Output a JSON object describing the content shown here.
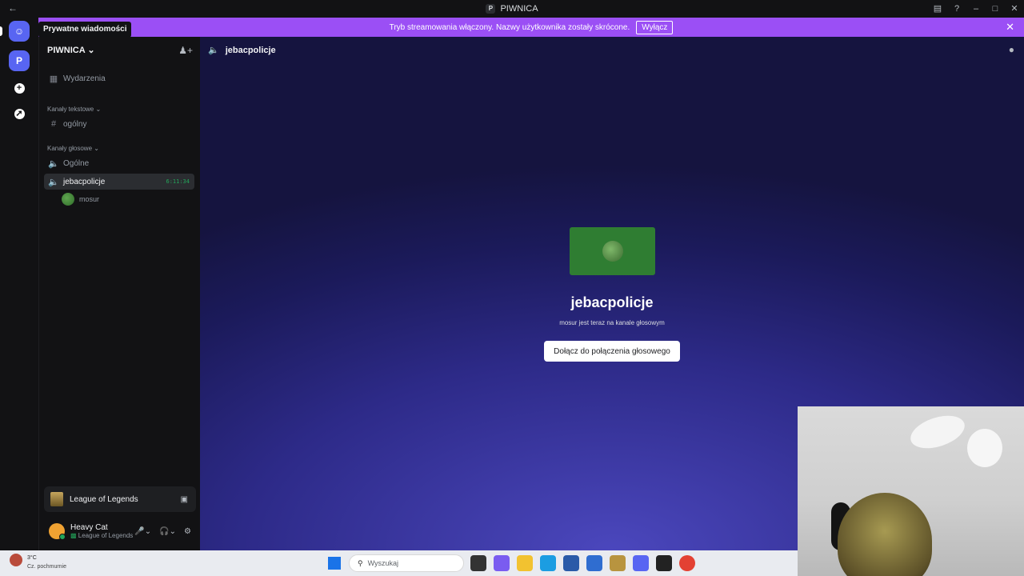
{
  "window": {
    "title": "PIWNICA",
    "badge": "P"
  },
  "banner": {
    "text": "Tryb streamowania włączony. Nazwy użytkownika zostały skrócone.",
    "button": "Wyłącz"
  },
  "rail": {
    "server_initial": "P",
    "tooltip": "Prywatne wiadomości"
  },
  "sidebar": {
    "server_name": "PIWNICA",
    "events": "Wydarzenia",
    "text_category": "Kanały tekstowe",
    "text_channels": [
      "ogólny"
    ],
    "voice_category": "Kanały głosowe",
    "voice_channels": [
      "Ogólne",
      "jebacpolicje"
    ],
    "active_timer": "6:11:34",
    "member": "mosur"
  },
  "activity": {
    "game": "League of Legends"
  },
  "user": {
    "name": "Heavy Cat",
    "status": "League of Legends"
  },
  "main": {
    "channel": "jebacpolicje",
    "voice_title": "jebacpolicje",
    "voice_subtitle": "mosur jest teraz na kanale głosowym",
    "join_button": "Dołącz do połączenia głosowego"
  },
  "taskbar": {
    "weather_temp": "3°C",
    "weather_desc": "Cz. pochmurnie",
    "search_placeholder": "Wyszukaj"
  },
  "colors": {
    "accent": "#5865f2",
    "banner": "#9b4ff5",
    "online": "#23a55a"
  }
}
